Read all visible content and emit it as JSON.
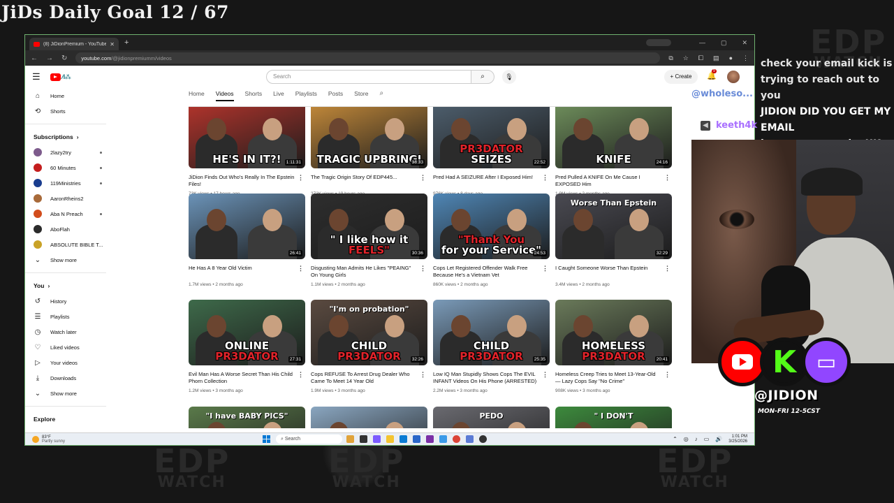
{
  "overlay": {
    "goal": "JiDs Daily Goal 12 / 67",
    "watermark_top": "EDP",
    "watermark_bottom": "WATCH",
    "chat": [
      {
        "text": "check your email kick is trying to reach out to you"
      },
      {
        "text": "JIDION DID YOU GET MY EMAIL"
      },
      {
        "text": "have you seen the UK pred"
      }
    ],
    "chat_user_top": "@wholeso...",
    "chat_user": "keeth4k",
    "handle": "@JIDION",
    "schedule": "MON-FRI 12-5CST"
  },
  "browser": {
    "tab_title": "(8) JiDionPremium - YouTube",
    "url_host": "youtube.com",
    "url_path": "/@jidionpremiumm/videos"
  },
  "youtube": {
    "search_placeholder": "Search",
    "create_label": "Create",
    "notif_count": "9",
    "sidebar": {
      "main": [
        {
          "label": "Home",
          "icon": "⌂"
        },
        {
          "label": "Shorts",
          "icon": "⟲"
        }
      ],
      "subs_heading": "Subscriptions",
      "subs": [
        {
          "label": "2lazy2try",
          "color": "#7d5b8c",
          "dot": true
        },
        {
          "label": "60 Minutes",
          "color": "#c41e1e",
          "dot": true
        },
        {
          "label": "119Ministries",
          "color": "#1a3d8f",
          "dot": true
        },
        {
          "label": "AaronRheins2",
          "color": "#a86a3a",
          "dot": false
        },
        {
          "label": "Aba N Preach",
          "color": "#d24d1c",
          "dot": true
        },
        {
          "label": "AboFlah",
          "color": "#2b2b2b",
          "dot": false
        },
        {
          "label": "ABSOLUTE BIBLE T...",
          "color": "#c9a227",
          "dot": false
        }
      ],
      "subs_more": "Show more",
      "you_heading": "You",
      "you": [
        {
          "label": "History",
          "icon": "↺"
        },
        {
          "label": "Playlists",
          "icon": "☰"
        },
        {
          "label": "Watch later",
          "icon": "◷"
        },
        {
          "label": "Liked videos",
          "icon": "♡"
        },
        {
          "label": "Your videos",
          "icon": "▷"
        },
        {
          "label": "Downloads",
          "icon": "⤓"
        }
      ],
      "you_more": "Show more",
      "explore_heading": "Explore"
    },
    "channel_tabs": [
      "Home",
      "Videos",
      "Shorts",
      "Live",
      "Playlists",
      "Posts",
      "Store"
    ],
    "active_tab": "Videos",
    "videos": [
      {
        "title": "JiDion Finds Out Who's Really In The Epstein Files!",
        "meta": "73K views • 17 hours ago",
        "duration": "1:11:31",
        "thumb_text": "HE'S IN IT?!",
        "thumb_red": "",
        "thumb_top": "",
        "bg": "#b3342c"
      },
      {
        "title": "The Tragic Origin Story Of EDP445...",
        "meta": "373K views • 19 hours ago",
        "duration": "38:33",
        "thumb_text": "TRAGIC UPBRINGI",
        "thumb_red": "",
        "thumb_top": "",
        "bg": "#c48a3a"
      },
      {
        "title": "Pred Had A SEIZURE After I Exposed Him!",
        "meta": "976K views • 8 days ago",
        "duration": "22:52",
        "thumb_text": "PR3DATOR",
        "thumb_red": "",
        "thumb_top": "",
        "thumb_text2": "SEIZES",
        "bg": "#4e5f6e"
      },
      {
        "title": "Pred Pulled A KNIFE On Me Cause I EXPOSED Him",
        "meta": "1.9M views • 2 months ago",
        "duration": "24:16",
        "thumb_text": "KNIFE",
        "thumb_red": "",
        "thumb_top": "",
        "bg": "#6f8f5c"
      },
      {
        "title": "He Has A 8 Year Old Victim",
        "meta": "1.7M views • 2 months ago",
        "duration": "26:41",
        "thumb_text": "",
        "thumb_red": "",
        "thumb_top": "",
        "bg": "#6b93b8"
      },
      {
        "title": "Disgusting Man Admits He Likes \"PEAING\" On Young Girls",
        "meta": "1.1M views • 2 months ago",
        "duration": "30:36",
        "thumb_text": "\" I like how it",
        "thumb_red": "FEELS\"",
        "thumb_top": "",
        "bg": "#2e2e2e"
      },
      {
        "title": "Cops Let Registered Offender Walk Free Because He's a Vietnam Vet",
        "meta": "860K views • 2 months ago",
        "duration": "24:53",
        "thumb_text": "for your Service\"",
        "thumb_red": "\"Thank You",
        "thumb_top": "",
        "bg": "#4f86b5"
      },
      {
        "title": "I Caught Someone Worse Than Epstein",
        "meta": "3.4M views • 2 months ago",
        "duration": "32:29",
        "thumb_text": "",
        "thumb_red": "",
        "thumb_top": "Worse Than Epstein",
        "bg": "#4a4a52"
      },
      {
        "title": "Evil Man Has A Worse Secret Than His Child Phorn Collection",
        "meta": "1.2M views • 3 months ago",
        "duration": "27:31",
        "thumb_text": "ONLINE",
        "thumb_red": "PR3DATOR",
        "thumb_top": "",
        "bg": "#3e6a4a"
      },
      {
        "title": "Cops REFUSE To Arrest Drug Dealer Who Came To Meet 14 Year Old",
        "meta": "1.9M views • 3 months ago",
        "duration": "32:26",
        "thumb_text": "CHILD",
        "thumb_red": "PR3DATOR",
        "thumb_top": "\"I'm on probation\"",
        "bg": "#5a4a40"
      },
      {
        "title": "Low IQ Man Stupidly Shows Cops The EVIL INFANT Videos On His Phone (ARRESTED)",
        "meta": "2.2M views • 3 months ago",
        "duration": "25:35",
        "thumb_text": "CHILD",
        "thumb_red": "PR3DATOR",
        "thumb_top": "",
        "bg": "#7a9ab8"
      },
      {
        "title": "Homeless Creep Tries to Meet 13-Year-Old — Lazy Cops Say \"No Crime\"",
        "meta": "908K views • 3 months ago",
        "duration": "20:41",
        "thumb_text": "HOMELESS",
        "thumb_red": "PR3DATOR",
        "thumb_top": "",
        "bg": "#6a7a5a"
      },
      {
        "title": "",
        "meta": "",
        "duration": "",
        "thumb_text": "",
        "thumb_red": "",
        "thumb_top": "\"I have BABY PICS\"",
        "bg": "#5a7a4a"
      },
      {
        "title": "",
        "meta": "",
        "duration": "",
        "thumb_text": "",
        "thumb_red": "",
        "thumb_top": "",
        "bg": "#8aa6c0"
      },
      {
        "title": "",
        "meta": "",
        "duration": "",
        "thumb_text": "",
        "thumb_red": "",
        "thumb_top": "PEDO",
        "bg": "#6a6a70"
      },
      {
        "title": "",
        "meta": "",
        "duration": "",
        "thumb_text": "",
        "thumb_red": "",
        "thumb_top": "\" I DON'T",
        "bg": "#3d8a3d"
      }
    ]
  },
  "taskbar": {
    "temp": "83°F",
    "weather": "Partly sunny",
    "search": "Search",
    "time": "1:01 PM",
    "date": "3/25/2026"
  }
}
